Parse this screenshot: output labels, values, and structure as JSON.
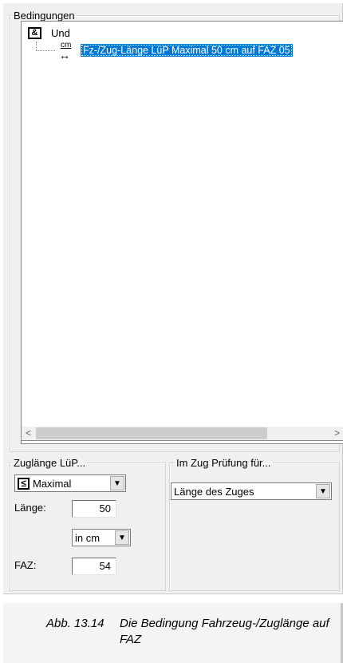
{
  "conditions": {
    "legend": "Bedingungen",
    "tree": {
      "root_label": "Und",
      "child_label": "Fz-/Zug-Länge LüP Maximal 50 cm auf FAZ 05",
      "cm_icon_text": "cm"
    },
    "scroll_left": "<",
    "scroll_right": ">"
  },
  "zuglaenge": {
    "legend": "Zuglänge LüP...",
    "mode_value": "Maximal",
    "laenge_label": "Länge:",
    "laenge_value": "50",
    "unit_value": "in cm",
    "faz_label": "FAZ:",
    "faz_value": "54"
  },
  "im_zug": {
    "legend": "Im Zug Prüfung für...",
    "select_value": "Länge des Zuges"
  },
  "caption": {
    "number": "Abb. 13.14",
    "text": "Die Bedingung Fahrzeug-/Zuglänge auf FAZ"
  }
}
